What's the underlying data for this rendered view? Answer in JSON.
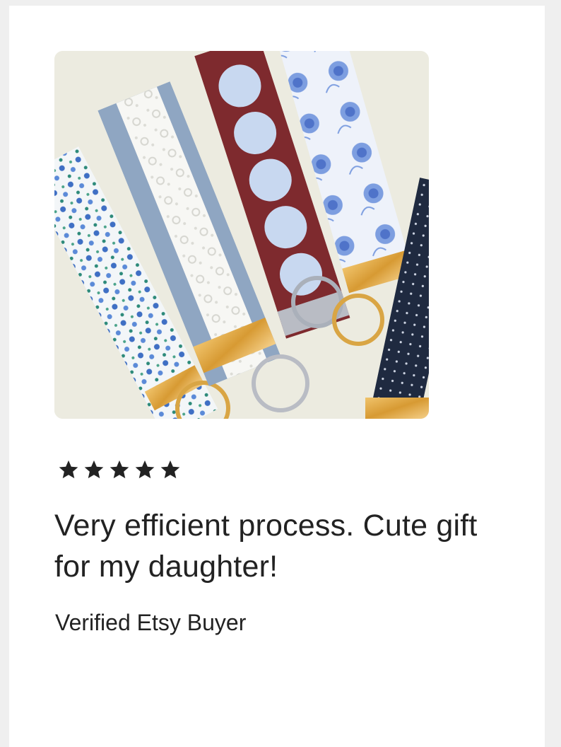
{
  "review": {
    "rating": 5,
    "rating_max": 5,
    "text": "Very efficient process. Cute gift for my daughter!",
    "reviewer": "Verified Etsy Buyer"
  },
  "photo": {
    "subject": "fabric key fob wristlets",
    "icon": "product-photo"
  },
  "colors": {
    "page_background": "#efefef",
    "card_background": "#ffffff",
    "text": "#222222",
    "star": "#222222"
  }
}
